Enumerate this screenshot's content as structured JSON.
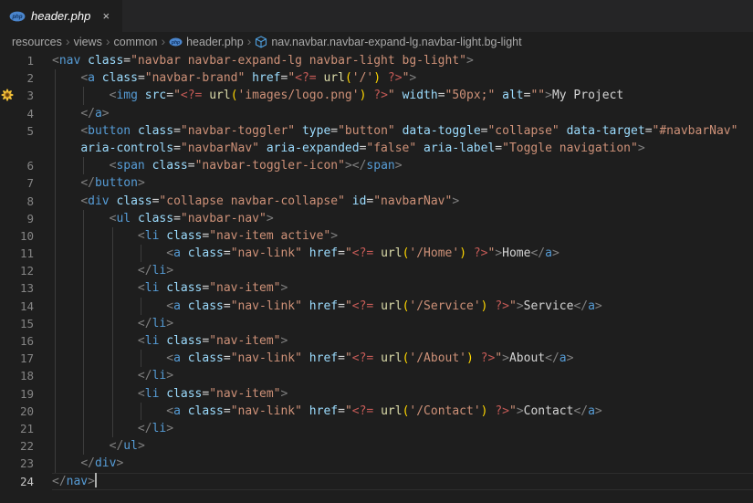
{
  "tab": {
    "title": "header.php",
    "icon": "php-icon",
    "close_label": "×"
  },
  "breadcrumbs": [
    "resources",
    "views",
    "common",
    "header.php",
    "nav.navbar.navbar-expand-lg.navbar-light.bg-light"
  ],
  "editor": {
    "current_line": 24,
    "syntax_colors": {
      "tag": "#569cd6",
      "attr": "#9cdcfe",
      "string": "#ce9178",
      "punctuation": "#808080",
      "equals": "#d4d4d4",
      "php_tag": "#c45a56",
      "function": "#dcdcaa",
      "bracket": "#ffd700",
      "text": "#d4d4d4",
      "plain": "#d4d4d4"
    },
    "rows": [
      {
        "n": "1",
        "t": [
          [
            "p",
            "<"
          ],
          [
            "t",
            "nav"
          ],
          [
            "w",
            " "
          ],
          [
            "a",
            "class"
          ],
          [
            "e",
            "="
          ],
          [
            "s",
            "\"navbar navbar-expand-lg navbar-light bg-light\""
          ],
          [
            "p",
            ">"
          ]
        ]
      },
      {
        "n": "2",
        "t": [
          [
            "w",
            "    "
          ],
          [
            "p",
            "<"
          ],
          [
            "t",
            "a"
          ],
          [
            "w",
            " "
          ],
          [
            "a",
            "class"
          ],
          [
            "e",
            "="
          ],
          [
            "s",
            "\"navbar-brand\""
          ],
          [
            "w",
            " "
          ],
          [
            "a",
            "href"
          ],
          [
            "e",
            "="
          ],
          [
            "s",
            "\""
          ],
          [
            "php",
            "<?="
          ],
          [
            "w",
            " "
          ],
          [
            "f",
            "url"
          ],
          [
            "b",
            "("
          ],
          [
            "s",
            "'/'"
          ],
          [
            "b",
            ")"
          ],
          [
            "w",
            " "
          ],
          [
            "php",
            "?>"
          ],
          [
            "s",
            "\""
          ],
          [
            "p",
            ">"
          ]
        ]
      },
      {
        "n": "3",
        "glyph": "flower-code-action-icon",
        "t": [
          [
            "w",
            "        "
          ],
          [
            "p",
            "<"
          ],
          [
            "t",
            "img"
          ],
          [
            "w",
            " "
          ],
          [
            "a",
            "src"
          ],
          [
            "e",
            "="
          ],
          [
            "s",
            "\""
          ],
          [
            "php",
            "<?="
          ],
          [
            "w",
            " "
          ],
          [
            "f",
            "url"
          ],
          [
            "b",
            "("
          ],
          [
            "s",
            "'images/logo.png'"
          ],
          [
            "b",
            ")"
          ],
          [
            "w",
            " "
          ],
          [
            "php",
            "?>"
          ],
          [
            "s",
            "\""
          ],
          [
            "w",
            " "
          ],
          [
            "a",
            "width"
          ],
          [
            "e",
            "="
          ],
          [
            "s",
            "\"50px;\""
          ],
          [
            "w",
            " "
          ],
          [
            "a",
            "alt"
          ],
          [
            "e",
            "="
          ],
          [
            "s",
            "\"\""
          ],
          [
            "p",
            ">"
          ],
          [
            "x",
            "My Project"
          ]
        ]
      },
      {
        "n": "4",
        "t": [
          [
            "w",
            "    "
          ],
          [
            "p",
            "</"
          ],
          [
            "t",
            "a"
          ],
          [
            "p",
            ">"
          ]
        ]
      },
      {
        "n": "5",
        "t": [
          [
            "w",
            "    "
          ],
          [
            "p",
            "<"
          ],
          [
            "t",
            "button"
          ],
          [
            "w",
            " "
          ],
          [
            "a",
            "class"
          ],
          [
            "e",
            "="
          ],
          [
            "s",
            "\"navbar-toggler\""
          ],
          [
            "w",
            " "
          ],
          [
            "a",
            "type"
          ],
          [
            "e",
            "="
          ],
          [
            "s",
            "\"button\""
          ],
          [
            "w",
            " "
          ],
          [
            "a",
            "data-toggle"
          ],
          [
            "e",
            "="
          ],
          [
            "s",
            "\"collapse\""
          ],
          [
            "w",
            " "
          ],
          [
            "a",
            "data-target"
          ],
          [
            "e",
            "="
          ],
          [
            "s",
            "\"#navbarNav\""
          ]
        ]
      },
      {
        "n": "",
        "t": [
          [
            "w",
            "    "
          ],
          [
            "a",
            "aria-controls"
          ],
          [
            "e",
            "="
          ],
          [
            "s",
            "\"navbarNav\""
          ],
          [
            "w",
            " "
          ],
          [
            "a",
            "aria-expanded"
          ],
          [
            "e",
            "="
          ],
          [
            "s",
            "\"false\""
          ],
          [
            "w",
            " "
          ],
          [
            "a",
            "aria-label"
          ],
          [
            "e",
            "="
          ],
          [
            "s",
            "\"Toggle navigation\""
          ],
          [
            "p",
            ">"
          ]
        ]
      },
      {
        "n": "6",
        "t": [
          [
            "w",
            "        "
          ],
          [
            "p",
            "<"
          ],
          [
            "t",
            "span"
          ],
          [
            "w",
            " "
          ],
          [
            "a",
            "class"
          ],
          [
            "e",
            "="
          ],
          [
            "s",
            "\"navbar-toggler-icon\""
          ],
          [
            "p",
            "></"
          ],
          [
            "t",
            "span"
          ],
          [
            "p",
            ">"
          ]
        ]
      },
      {
        "n": "7",
        "t": [
          [
            "w",
            "    "
          ],
          [
            "p",
            "</"
          ],
          [
            "t",
            "button"
          ],
          [
            "p",
            ">"
          ]
        ]
      },
      {
        "n": "8",
        "t": [
          [
            "w",
            "    "
          ],
          [
            "p",
            "<"
          ],
          [
            "t",
            "div"
          ],
          [
            "w",
            " "
          ],
          [
            "a",
            "class"
          ],
          [
            "e",
            "="
          ],
          [
            "s",
            "\"collapse navbar-collapse\""
          ],
          [
            "w",
            " "
          ],
          [
            "a",
            "id"
          ],
          [
            "e",
            "="
          ],
          [
            "s",
            "\"navbarNav\""
          ],
          [
            "p",
            ">"
          ]
        ]
      },
      {
        "n": "9",
        "t": [
          [
            "w",
            "        "
          ],
          [
            "p",
            "<"
          ],
          [
            "t",
            "ul"
          ],
          [
            "w",
            " "
          ],
          [
            "a",
            "class"
          ],
          [
            "e",
            "="
          ],
          [
            "s",
            "\"navbar-nav\""
          ],
          [
            "p",
            ">"
          ]
        ]
      },
      {
        "n": "10",
        "t": [
          [
            "w",
            "            "
          ],
          [
            "p",
            "<"
          ],
          [
            "t",
            "li"
          ],
          [
            "w",
            " "
          ],
          [
            "a",
            "class"
          ],
          [
            "e",
            "="
          ],
          [
            "s",
            "\"nav-item active\""
          ],
          [
            "p",
            ">"
          ]
        ]
      },
      {
        "n": "11",
        "t": [
          [
            "w",
            "                "
          ],
          [
            "p",
            "<"
          ],
          [
            "t",
            "a"
          ],
          [
            "w",
            " "
          ],
          [
            "a",
            "class"
          ],
          [
            "e",
            "="
          ],
          [
            "s",
            "\"nav-link\""
          ],
          [
            "w",
            " "
          ],
          [
            "a",
            "href"
          ],
          [
            "e",
            "="
          ],
          [
            "s",
            "\""
          ],
          [
            "php",
            "<?="
          ],
          [
            "w",
            " "
          ],
          [
            "f",
            "url"
          ],
          [
            "b",
            "("
          ],
          [
            "s",
            "'/Home'"
          ],
          [
            "b",
            ")"
          ],
          [
            "w",
            " "
          ],
          [
            "php",
            "?>"
          ],
          [
            "s",
            "\""
          ],
          [
            "p",
            ">"
          ],
          [
            "x",
            "Home"
          ],
          [
            "p",
            "</"
          ],
          [
            "t",
            "a"
          ],
          [
            "p",
            ">"
          ]
        ]
      },
      {
        "n": "12",
        "t": [
          [
            "w",
            "            "
          ],
          [
            "p",
            "</"
          ],
          [
            "t",
            "li"
          ],
          [
            "p",
            ">"
          ]
        ]
      },
      {
        "n": "13",
        "t": [
          [
            "w",
            "            "
          ],
          [
            "p",
            "<"
          ],
          [
            "t",
            "li"
          ],
          [
            "w",
            " "
          ],
          [
            "a",
            "class"
          ],
          [
            "e",
            "="
          ],
          [
            "s",
            "\"nav-item\""
          ],
          [
            "p",
            ">"
          ]
        ]
      },
      {
        "n": "14",
        "t": [
          [
            "w",
            "                "
          ],
          [
            "p",
            "<"
          ],
          [
            "t",
            "a"
          ],
          [
            "w",
            " "
          ],
          [
            "a",
            "class"
          ],
          [
            "e",
            "="
          ],
          [
            "s",
            "\"nav-link\""
          ],
          [
            "w",
            " "
          ],
          [
            "a",
            "href"
          ],
          [
            "e",
            "="
          ],
          [
            "s",
            "\""
          ],
          [
            "php",
            "<?="
          ],
          [
            "w",
            " "
          ],
          [
            "f",
            "url"
          ],
          [
            "b",
            "("
          ],
          [
            "s",
            "'/Service'"
          ],
          [
            "b",
            ")"
          ],
          [
            "w",
            " "
          ],
          [
            "php",
            "?>"
          ],
          [
            "s",
            "\""
          ],
          [
            "p",
            ">"
          ],
          [
            "x",
            "Service"
          ],
          [
            "p",
            "</"
          ],
          [
            "t",
            "a"
          ],
          [
            "p",
            ">"
          ]
        ]
      },
      {
        "n": "15",
        "t": [
          [
            "w",
            "            "
          ],
          [
            "p",
            "</"
          ],
          [
            "t",
            "li"
          ],
          [
            "p",
            ">"
          ]
        ]
      },
      {
        "n": "16",
        "t": [
          [
            "w",
            "            "
          ],
          [
            "p",
            "<"
          ],
          [
            "t",
            "li"
          ],
          [
            "w",
            " "
          ],
          [
            "a",
            "class"
          ],
          [
            "e",
            "="
          ],
          [
            "s",
            "\"nav-item\""
          ],
          [
            "p",
            ">"
          ]
        ]
      },
      {
        "n": "17",
        "t": [
          [
            "w",
            "                "
          ],
          [
            "p",
            "<"
          ],
          [
            "t",
            "a"
          ],
          [
            "w",
            " "
          ],
          [
            "a",
            "class"
          ],
          [
            "e",
            "="
          ],
          [
            "s",
            "\"nav-link\""
          ],
          [
            "w",
            " "
          ],
          [
            "a",
            "href"
          ],
          [
            "e",
            "="
          ],
          [
            "s",
            "\""
          ],
          [
            "php",
            "<?="
          ],
          [
            "w",
            " "
          ],
          [
            "f",
            "url"
          ],
          [
            "b",
            "("
          ],
          [
            "s",
            "'/About'"
          ],
          [
            "b",
            ")"
          ],
          [
            "w",
            " "
          ],
          [
            "php",
            "?>"
          ],
          [
            "s",
            "\""
          ],
          [
            "p",
            ">"
          ],
          [
            "x",
            "About"
          ],
          [
            "p",
            "</"
          ],
          [
            "t",
            "a"
          ],
          [
            "p",
            ">"
          ]
        ]
      },
      {
        "n": "18",
        "t": [
          [
            "w",
            "            "
          ],
          [
            "p",
            "</"
          ],
          [
            "t",
            "li"
          ],
          [
            "p",
            ">"
          ]
        ]
      },
      {
        "n": "19",
        "t": [
          [
            "w",
            "            "
          ],
          [
            "p",
            "<"
          ],
          [
            "t",
            "li"
          ],
          [
            "w",
            " "
          ],
          [
            "a",
            "class"
          ],
          [
            "e",
            "="
          ],
          [
            "s",
            "\"nav-item\""
          ],
          [
            "p",
            ">"
          ]
        ]
      },
      {
        "n": "20",
        "t": [
          [
            "w",
            "                "
          ],
          [
            "p",
            "<"
          ],
          [
            "t",
            "a"
          ],
          [
            "w",
            " "
          ],
          [
            "a",
            "class"
          ],
          [
            "e",
            "="
          ],
          [
            "s",
            "\"nav-link\""
          ],
          [
            "w",
            " "
          ],
          [
            "a",
            "href"
          ],
          [
            "e",
            "="
          ],
          [
            "s",
            "\""
          ],
          [
            "php",
            "<?="
          ],
          [
            "w",
            " "
          ],
          [
            "f",
            "url"
          ],
          [
            "b",
            "("
          ],
          [
            "s",
            "'/Contact'"
          ],
          [
            "b",
            ")"
          ],
          [
            "w",
            " "
          ],
          [
            "php",
            "?>"
          ],
          [
            "s",
            "\""
          ],
          [
            "p",
            ">"
          ],
          [
            "x",
            "Contact"
          ],
          [
            "p",
            "</"
          ],
          [
            "t",
            "a"
          ],
          [
            "p",
            ">"
          ]
        ]
      },
      {
        "n": "21",
        "t": [
          [
            "w",
            "            "
          ],
          [
            "p",
            "</"
          ],
          [
            "t",
            "li"
          ],
          [
            "p",
            ">"
          ]
        ]
      },
      {
        "n": "22",
        "t": [
          [
            "w",
            "        "
          ],
          [
            "p",
            "</"
          ],
          [
            "t",
            "ul"
          ],
          [
            "p",
            ">"
          ]
        ]
      },
      {
        "n": "23",
        "t": [
          [
            "w",
            "    "
          ],
          [
            "p",
            "</"
          ],
          [
            "t",
            "div"
          ],
          [
            "p",
            ">"
          ]
        ]
      },
      {
        "n": "24",
        "current": true,
        "cursor": true,
        "t": [
          [
            "p",
            "</"
          ],
          [
            "t",
            "nav"
          ],
          [
            "p",
            ">"
          ]
        ]
      }
    ]
  }
}
